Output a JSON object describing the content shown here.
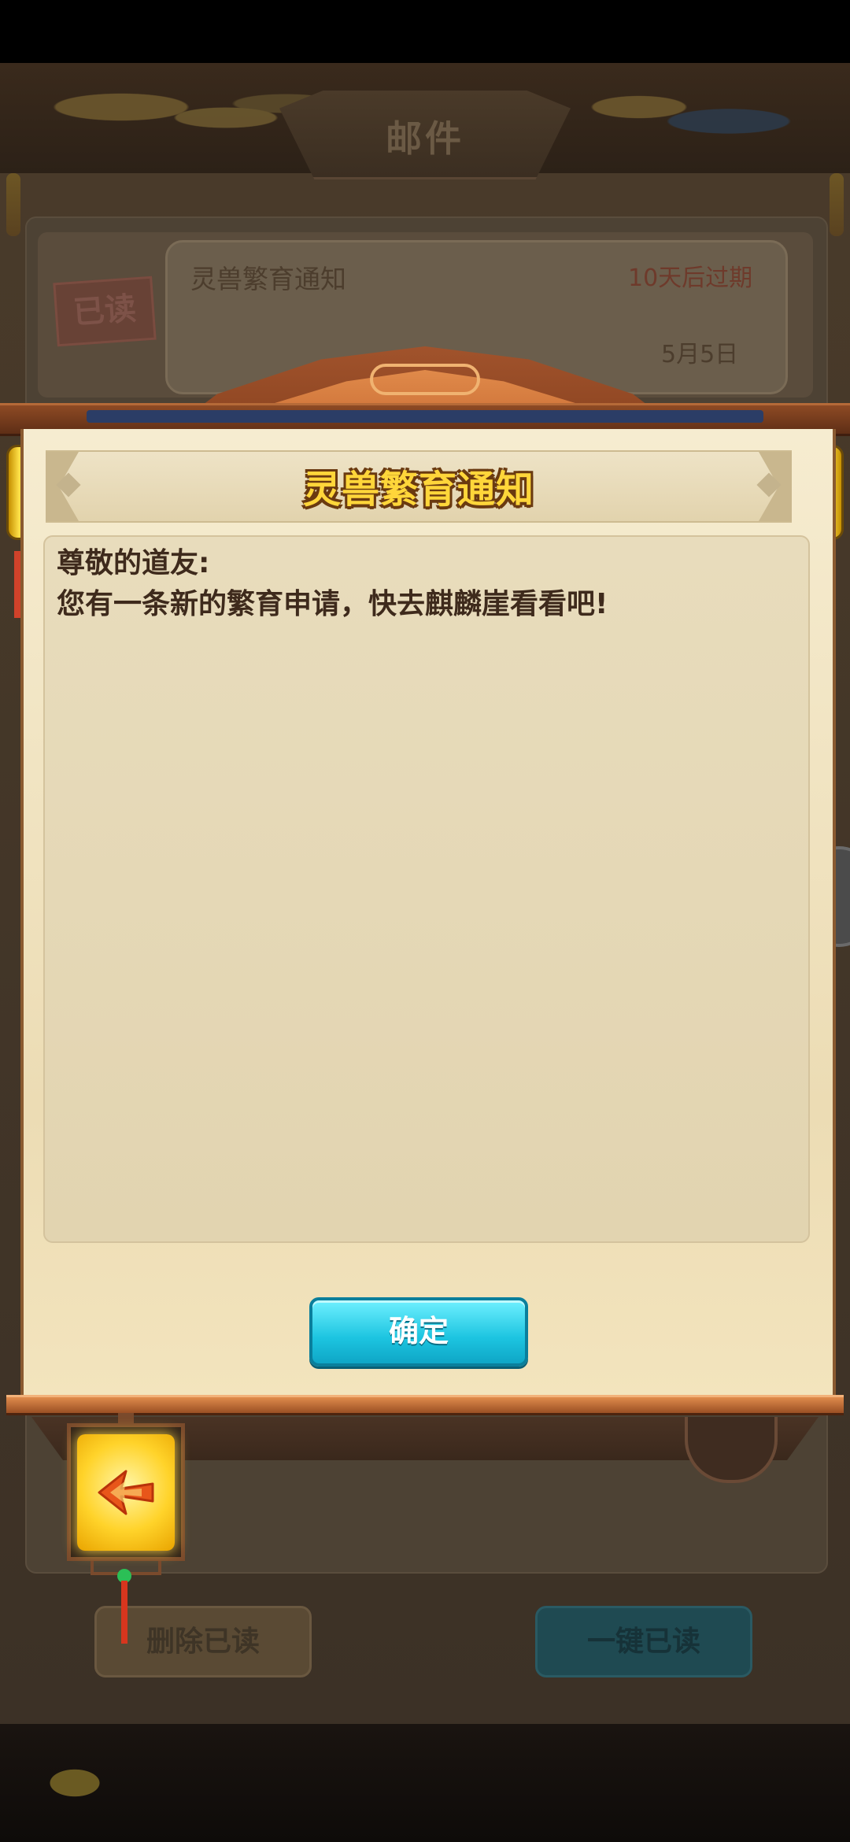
{
  "background": {
    "window_title": "邮件",
    "mail_item": {
      "read_stamp": "已读",
      "subject": "灵兽繁育通知",
      "expire": "10天后过期",
      "date": "5月5日"
    },
    "delete_read_label": "删除已读",
    "read_all_label": "一键已读"
  },
  "dialog": {
    "title": "灵兽繁育通知",
    "greeting": "尊敬的道友:",
    "body": "您有一条新的繁育申请，快去麒麟崖看看吧!",
    "confirm_label": "确定"
  },
  "icons": {
    "back": "back-arrow-icon"
  },
  "colors": {
    "title_gold": "#ffd63a",
    "confirm_cyan": "#1cc4e0",
    "paper": "#f0e2c0"
  }
}
